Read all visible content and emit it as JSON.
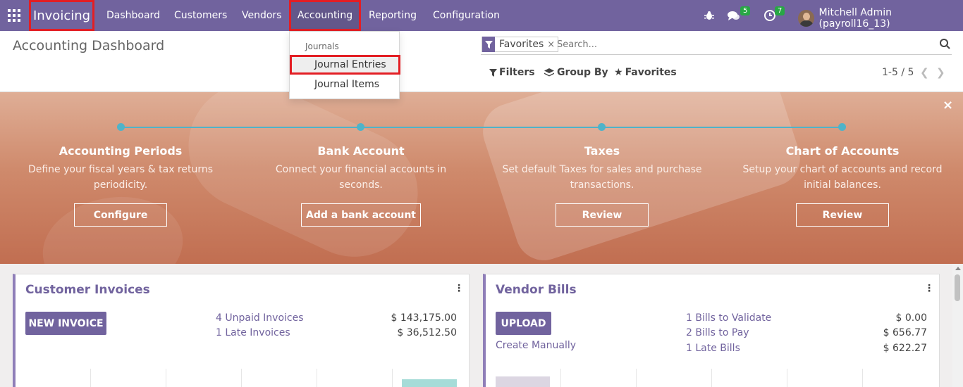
{
  "navbar": {
    "brand": "Invoicing",
    "menu": [
      "Dashboard",
      "Customers",
      "Vendors",
      "Accounting",
      "Reporting",
      "Configuration"
    ],
    "messages_count": "5",
    "activities_count": "7",
    "user_name": "Mitchell Admin (payroll16_13)"
  },
  "accounting_menu": {
    "section_header": "Journals",
    "items": [
      "Journal Entries",
      "Journal Items"
    ]
  },
  "control_panel": {
    "title": "Accounting Dashboard",
    "facet_label": "Favorites",
    "facet_remove": "×",
    "search_placeholder": "Search...",
    "filters_label": "Filters",
    "group_by_label": "Group By",
    "favorites_label": "Favorites",
    "pager": "1-5 / 5"
  },
  "onboarding": {
    "close": "×",
    "steps": [
      {
        "title": "Accounting Periods",
        "desc1": "Define your fiscal years & tax returns",
        "desc2": "periodicity.",
        "button": "Configure"
      },
      {
        "title": "Bank Account",
        "desc1": "Connect your financial accounts in",
        "desc2": "seconds.",
        "button": "Add a bank account"
      },
      {
        "title": "Taxes",
        "desc1": "Set default Taxes for sales and purchase",
        "desc2": "transactions.",
        "button": "Review"
      },
      {
        "title": "Chart of Accounts",
        "desc1": "Setup your chart of accounts and record",
        "desc2": "initial balances.",
        "button": "Review"
      }
    ],
    "timeline_color": "#4fb3c9"
  },
  "cards": {
    "customer_invoices": {
      "title": "Customer Invoices",
      "menu": "⋮",
      "button": "NEW INVOICE",
      "rows": [
        {
          "label": "4 Unpaid Invoices",
          "amount": "$ 143,175.00"
        },
        {
          "label": "1 Late Invoices",
          "amount": "$ 36,512.50"
        }
      ]
    },
    "vendor_bills": {
      "title": "Vendor Bills",
      "menu": "⋮",
      "button": "UPLOAD",
      "secondary_link": "Create Manually",
      "rows": [
        {
          "label": "1 Bills to Validate",
          "amount": "$ 0.00"
        },
        {
          "label": "2 Bills to Pay",
          "amount": "$ 656.77"
        },
        {
          "label": "1 Late Bills",
          "amount": "$ 622.27"
        }
      ]
    }
  },
  "colors": {
    "brand": "#71639e",
    "highlight": "#e31e24",
    "badge": "#28a745"
  }
}
